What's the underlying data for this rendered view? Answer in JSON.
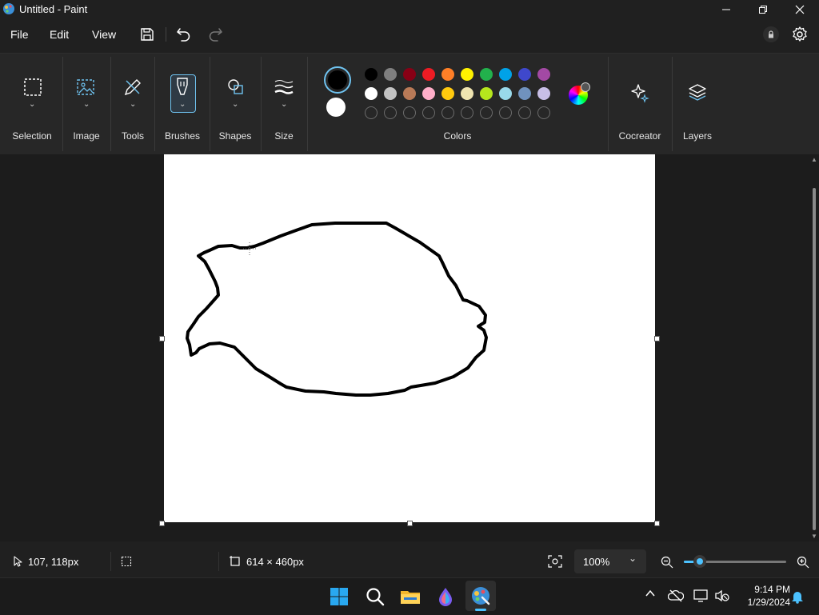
{
  "window": {
    "title": "Untitled - Paint",
    "controls": [
      "minimize",
      "restore",
      "close"
    ]
  },
  "menu": {
    "file": "File",
    "edit": "Edit",
    "view": "View"
  },
  "ribbon": {
    "selection": "Selection",
    "image": "Image",
    "tools": "Tools",
    "brushes": "Brushes",
    "shapes": "Shapes",
    "size": "Size",
    "colors": "Colors",
    "cocreator": "Cocreator",
    "layers": "Layers",
    "primary_color": "#000000",
    "secondary_color": "#ffffff",
    "palette_row1": [
      "#000000",
      "#7f7f7f",
      "#880015",
      "#ed1c24",
      "#ff7f27",
      "#fff200",
      "#22b14c",
      "#00a2e8",
      "#3f48cc",
      "#a349a4"
    ],
    "palette_row2": [
      "#ffffff",
      "#c3c3c3",
      "#b97a57",
      "#ffaec9",
      "#ffc90e",
      "#efe4b0",
      "#b5e61d",
      "#99d9ea",
      "#7092be",
      "#c8bfe7"
    ]
  },
  "status": {
    "cursor_position": "107, 118px",
    "canvas_size": "614 × 460px",
    "zoom": "100%"
  },
  "taskbar": {
    "time": "9:14 PM",
    "date": "1/29/2024"
  }
}
